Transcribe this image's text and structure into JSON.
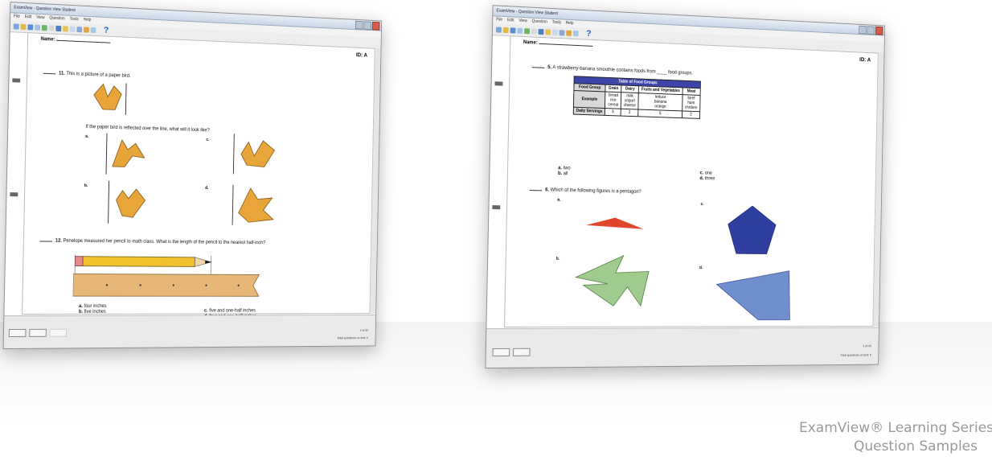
{
  "caption": {
    "line1": "ExamView® Learning Series",
    "line2": "Question Samples"
  },
  "window_left": {
    "title": "ExamView - Question View Student",
    "menu": [
      "File",
      "Edit",
      "View",
      "Question",
      "Tools",
      "Help"
    ],
    "header": {
      "name_label": "Name:",
      "id_label": "ID: A"
    },
    "question_11": {
      "number": "11.",
      "prompt": "This is a picture of a paper bird.",
      "followup": "If the paper bird is reflected over the line, what will it look like?",
      "choices": [
        "a.",
        "b.",
        "c.",
        "d."
      ]
    },
    "question_12": {
      "number": "12.",
      "prompt": "Penelope measured her pencil to math class. What is the length of the pencil to the nearest half-inch?",
      "answers": [
        {
          "letter": "a.",
          "text": "four inches"
        },
        {
          "letter": "b.",
          "text": "five inches"
        },
        {
          "letter": "c.",
          "text": "five and one-half inches"
        },
        {
          "letter": "d.",
          "text": "four and one-half inches"
        }
      ]
    },
    "footer": {
      "status1": "1 of 25",
      "status2": "Total questions on test: 5"
    }
  },
  "window_right": {
    "title": "ExamView - Question View Student",
    "menu": [
      "File",
      "Edit",
      "View",
      "Question",
      "Tools",
      "Help"
    ],
    "header": {
      "name_label": "Name:",
      "id_label": "ID: A"
    },
    "question_5": {
      "number": "5.",
      "prompt": "A strawberry-banana smoothie contains foods from ____ food groups.",
      "table": {
        "caption": "Table of Food Groups",
        "headers": [
          "Food Group",
          "Grain",
          "Dairy",
          "Fruits and Vegetables",
          "Meat"
        ],
        "rows": [
          [
            "Example",
            "bread\nrice\ncereal",
            "milk\nyogurt\ncheese",
            "lettuce\nbanana\norange",
            "beef\nham\nchicken"
          ],
          [
            "Daily Servings",
            "6",
            "2",
            "5",
            "2"
          ]
        ]
      },
      "answers": [
        {
          "letter": "a.",
          "text": "two"
        },
        {
          "letter": "b.",
          "text": "all"
        },
        {
          "letter": "c.",
          "text": "one"
        },
        {
          "letter": "d.",
          "text": "three"
        }
      ]
    },
    "question_6": {
      "number": "6.",
      "prompt": "Which of the following figures is a pentagon?",
      "choices": [
        "a.",
        "b.",
        "c.",
        "d."
      ]
    },
    "footer": {
      "status1": "1 of 25",
      "status2": "Total questions on test: 5"
    }
  },
  "colors": {
    "pentagon": "#2f3f9f",
    "quad": "#6f8fcf",
    "triangle": "#e0462b",
    "zigzag": "#9fcb8f",
    "crane": "#e8a53a",
    "table_header": "#3d45a8",
    "help": "#2b5ed6"
  }
}
